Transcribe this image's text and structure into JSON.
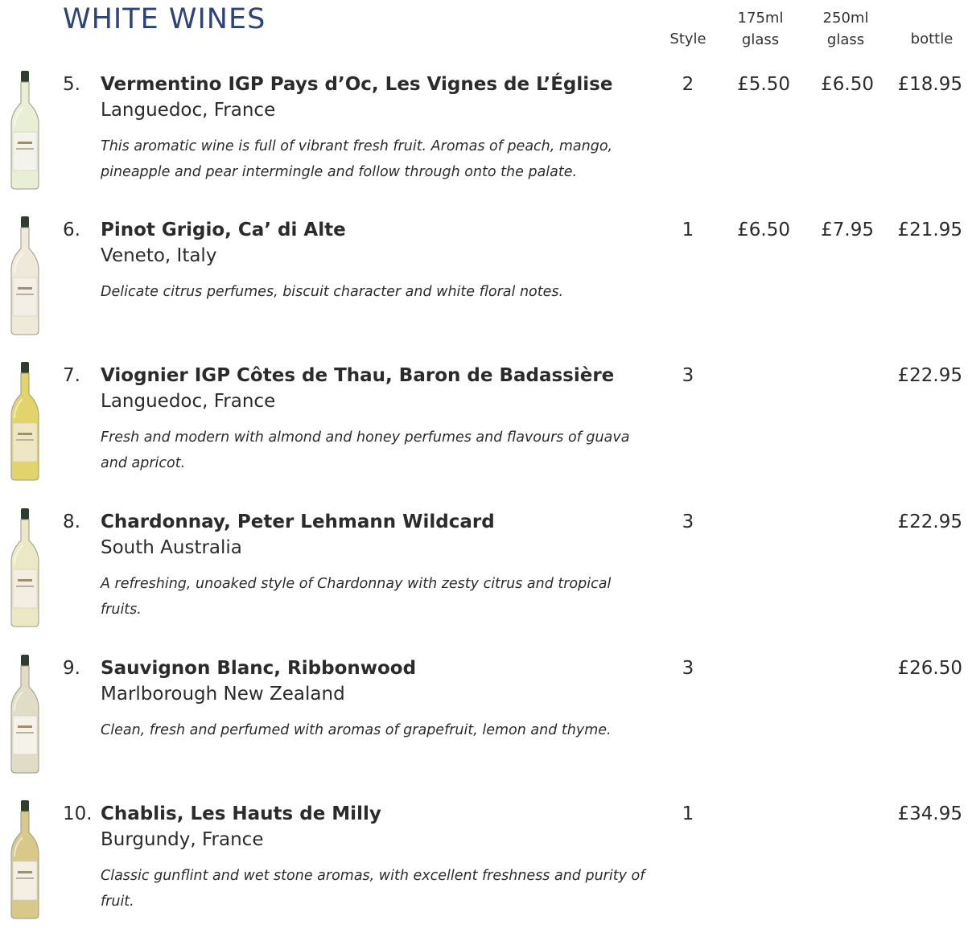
{
  "title": "WHITE WINES",
  "columns": {
    "style": "Style",
    "glass175_top": "175ml",
    "glass175_bottom": "glass",
    "glass250_top": "250ml",
    "glass250_bottom": "glass",
    "bottle": "bottle"
  },
  "wines": [
    {
      "num": "5.",
      "name": "Vermentino IGP Pays d’Oc, Les Vignes de L’Église",
      "region": "Languedoc, France",
      "desc": "This aromatic wine is full of vibrant fresh fruit. Aromas of peach, mango, pineapple and pear intermingle and follow through onto the palate.",
      "style": "2",
      "p175": "£5.50",
      "p250": "£6.50",
      "bottle": "£18.95",
      "bottle_icon": "white-wine-bottle-icon",
      "glass_color": "#e9efd5",
      "label_color": "#f3f2ec"
    },
    {
      "num": "6.",
      "name": "Pinot Grigio, Ca’ di Alte",
      "region": "Veneto, Italy",
      "desc": "Delicate citrus perfumes, biscuit character and white floral notes.",
      "style": "1",
      "p175": "£6.50",
      "p250": "£7.95",
      "bottle": "£21.95",
      "bottle_icon": "white-wine-bottle-icon",
      "glass_color": "#eee9d8",
      "label_color": "#f4efe6"
    },
    {
      "num": "7.",
      "name": "Viognier IGP Côtes de Thau, Baron de Badassière",
      "region": "Languedoc, France",
      "desc": "Fresh and modern with almond and honey perfumes and flavours of guava and apricot.",
      "style": "3",
      "p175": "",
      "p250": "",
      "bottle": "£22.95",
      "bottle_icon": "white-wine-bottle-icon",
      "glass_color": "#e2d36a",
      "label_color": "#efe7c4"
    },
    {
      "num": "8.",
      "name": "Chardonnay, Peter Lehmann Wildcard",
      "region": "South Australia",
      "desc": "A refreshing, unoaked style of Chardonnay with zesty citrus and tropical fruits.",
      "style": "3",
      "p175": "",
      "p250": "",
      "bottle": "£22.95",
      "bottle_icon": "white-wine-bottle-icon",
      "glass_color": "#ece7c4",
      "label_color": "#f4eee2"
    },
    {
      "num": "9.",
      "name": "Sauvignon Blanc, Ribbonwood",
      "region": "Marlborough New Zealand",
      "desc": "Clean, fresh and perfumed with aromas of grapefruit, lemon and thyme.",
      "style": "3",
      "p175": "",
      "p250": "",
      "bottle": "£26.50",
      "bottle_icon": "white-wine-bottle-icon",
      "glass_color": "#e1dcc6",
      "label_color": "#f5f2ea"
    },
    {
      "num": "10.",
      "name": "Chablis, Les Hauts de Milly",
      "region": "Burgundy, France",
      "desc": "Classic gunflint and wet stone aromas, with excellent freshness and purity of fruit.",
      "style": "1",
      "p175": "",
      "p250": "",
      "bottle": "£34.95",
      "bottle_icon": "white-wine-bottle-icon",
      "glass_color": "#d8c98a",
      "label_color": "#f3efe4"
    }
  ]
}
